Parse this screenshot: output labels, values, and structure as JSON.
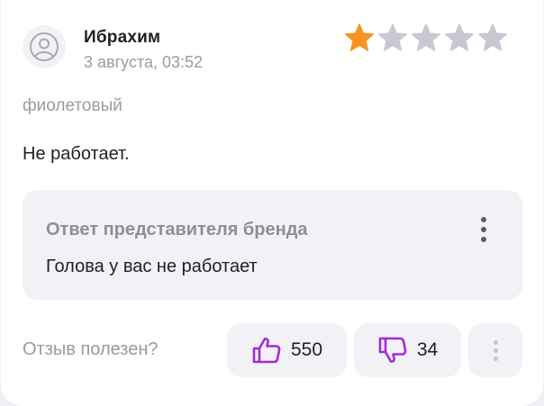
{
  "review": {
    "author": "Ибрахим",
    "date": "3 августа, 03:52",
    "rating": 1,
    "rating_max": 5,
    "variant": "фиолетовый",
    "text": "Не работает."
  },
  "brand_reply": {
    "title": "Ответ представителя бренда",
    "text": "Голова у вас не работает"
  },
  "helpful": {
    "label": "Отзыв полезен?",
    "likes": "550",
    "dislikes": "34"
  },
  "colors": {
    "star_active": "#f7931e",
    "star_inactive": "#c8c8d2",
    "accent_purple": "#a42bd6"
  }
}
